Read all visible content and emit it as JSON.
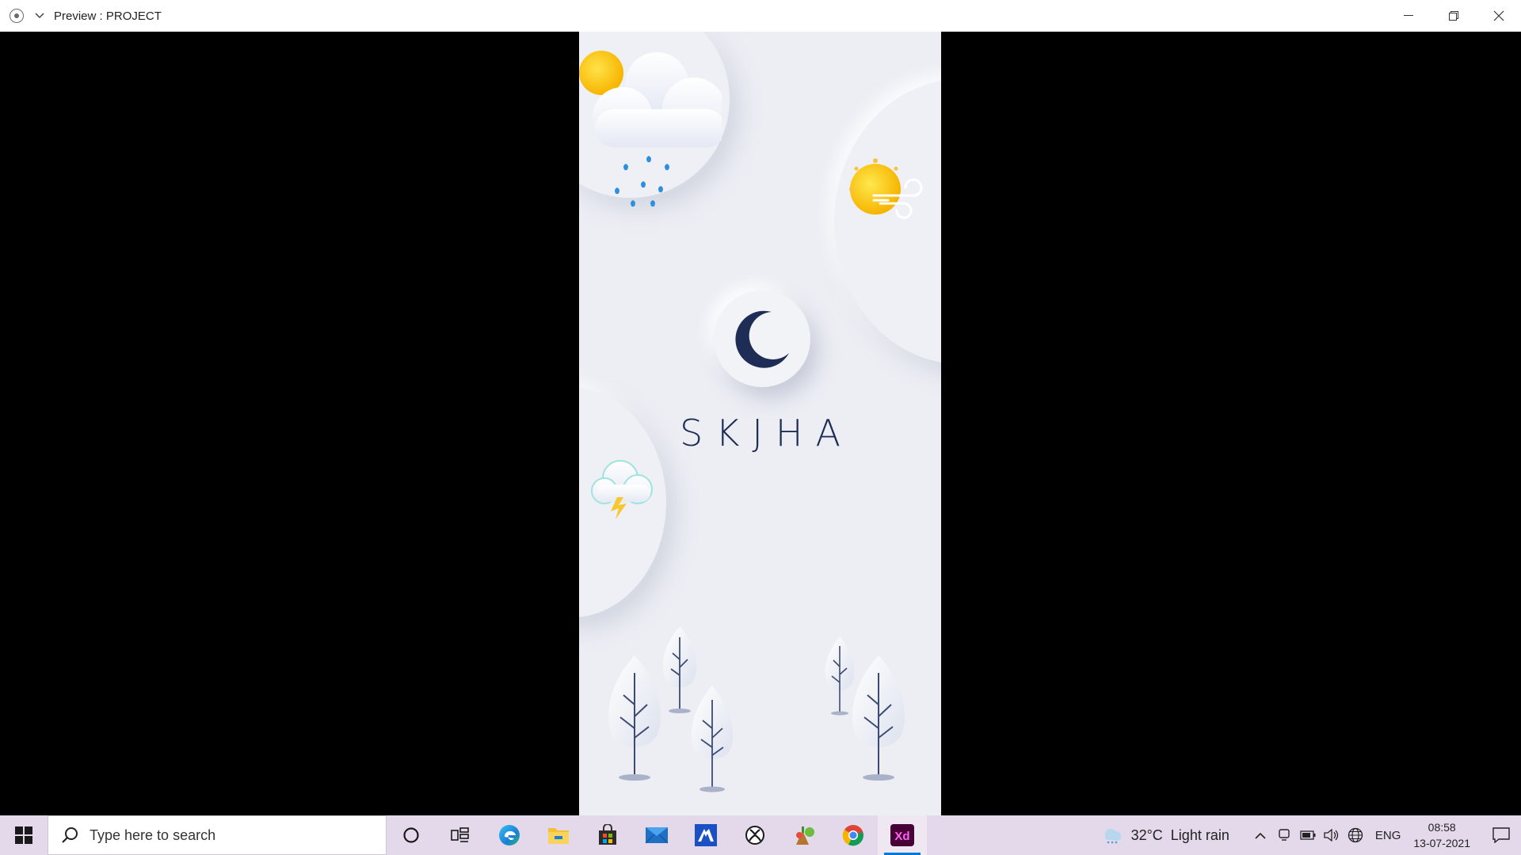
{
  "window": {
    "title": "Preview : PROJECT",
    "controls": [
      "minimize",
      "restore",
      "close"
    ]
  },
  "artboard": {
    "brand": "SKJHA",
    "icons": [
      "rain-cloud-icon",
      "sun-wind-icon",
      "moon-icon",
      "thunder-cloud-icon",
      "tree-icon"
    ]
  },
  "taskbar": {
    "search_placeholder": "Type here to search",
    "apps": [
      "cortana-icon",
      "task-view-icon",
      "edge-icon",
      "file-explorer-icon",
      "store-icon",
      "mail-icon",
      "ms-app-icon",
      "xbox-icon",
      "game-icon",
      "chrome-icon",
      "adobe-xd-icon"
    ],
    "active_app": "Xd",
    "weather": {
      "temp": "32°C",
      "condition": "Light rain"
    },
    "language": "ENG",
    "time": "08:58",
    "date": "13-07-2021"
  },
  "colors": {
    "brand_text": "#1e2d55",
    "artboard_bg": "#eceef4",
    "taskbar_bg": "#e3d9ea",
    "xd_purple": "#470137",
    "xd_pink": "#ff61f6"
  }
}
